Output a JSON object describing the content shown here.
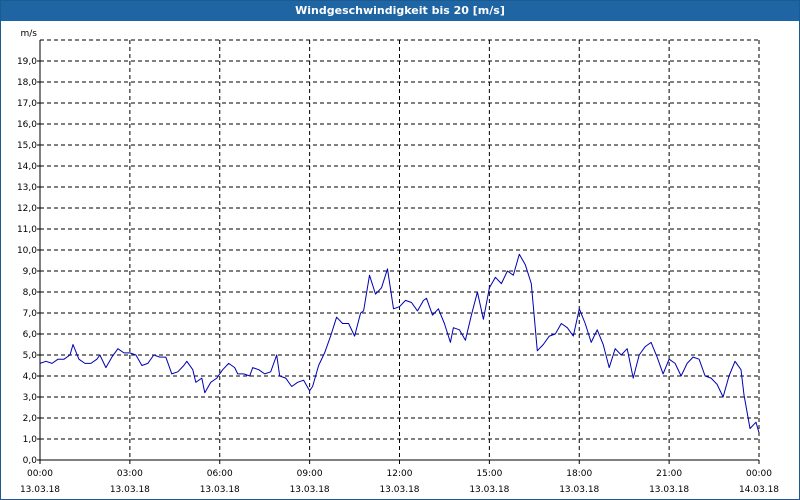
{
  "window": {
    "title": "Windgeschwindigkeit bis 20 [m/s]"
  },
  "chart_data": {
    "type": "line",
    "title": "Windgeschwindigkeit bis 20 [m/s]",
    "ylabel": "m/s",
    "xlabel": "",
    "ylim": [
      0,
      20
    ],
    "yticks": [
      "0,0",
      "1,0",
      "2,0",
      "3,0",
      "4,0",
      "5,0",
      "6,0",
      "7,0",
      "8,0",
      "9,0",
      "10,0",
      "11,0",
      "12,0",
      "13,0",
      "14,0",
      "15,0",
      "16,0",
      "17,0",
      "18,0",
      "19,0"
    ],
    "xlim_hours": [
      0,
      24
    ],
    "xticks": [
      {
        "h": 0,
        "time": "00:00",
        "date": "13.03.18"
      },
      {
        "h": 3,
        "time": "03:00",
        "date": "13.03.18"
      },
      {
        "h": 6,
        "time": "06:00",
        "date": "13.03.18"
      },
      {
        "h": 9,
        "time": "09:00",
        "date": "13.03.18"
      },
      {
        "h": 12,
        "time": "12:00",
        "date": "13.03.18"
      },
      {
        "h": 15,
        "time": "15:00",
        "date": "13.03.18"
      },
      {
        "h": 18,
        "time": "18:00",
        "date": "13.03.18"
      },
      {
        "h": 21,
        "time": "21:00",
        "date": "13.03.18"
      },
      {
        "h": 24,
        "time": "00:00",
        "date": "14.03.18"
      }
    ],
    "grid": true,
    "series": [
      {
        "color": "#0000b4",
        "points": [
          [
            0.0,
            4.6
          ],
          [
            0.2,
            4.7
          ],
          [
            0.4,
            4.6
          ],
          [
            0.6,
            4.8
          ],
          [
            0.8,
            4.8
          ],
          [
            1.0,
            5.0
          ],
          [
            1.1,
            5.5
          ],
          [
            1.3,
            4.8
          ],
          [
            1.5,
            4.6
          ],
          [
            1.7,
            4.6
          ],
          [
            1.9,
            4.8
          ],
          [
            2.0,
            5.0
          ],
          [
            2.2,
            4.4
          ],
          [
            2.4,
            4.9
          ],
          [
            2.6,
            5.3
          ],
          [
            2.8,
            5.1
          ],
          [
            3.0,
            5.1
          ],
          [
            3.2,
            5.0
          ],
          [
            3.4,
            4.5
          ],
          [
            3.6,
            4.6
          ],
          [
            3.8,
            5.0
          ],
          [
            4.0,
            4.9
          ],
          [
            4.2,
            4.9
          ],
          [
            4.4,
            4.1
          ],
          [
            4.6,
            4.2
          ],
          [
            4.8,
            4.5
          ],
          [
            4.9,
            4.7
          ],
          [
            5.1,
            4.3
          ],
          [
            5.2,
            3.7
          ],
          [
            5.4,
            3.9
          ],
          [
            5.5,
            3.2
          ],
          [
            5.7,
            3.7
          ],
          [
            5.9,
            3.9
          ],
          [
            6.1,
            4.3
          ],
          [
            6.3,
            4.6
          ],
          [
            6.5,
            4.4
          ],
          [
            6.6,
            4.1
          ],
          [
            6.8,
            4.1
          ],
          [
            7.0,
            4.0
          ],
          [
            7.1,
            4.4
          ],
          [
            7.3,
            4.3
          ],
          [
            7.5,
            4.1
          ],
          [
            7.7,
            4.2
          ],
          [
            7.9,
            5.0
          ],
          [
            8.0,
            4.0
          ],
          [
            8.2,
            3.9
          ],
          [
            8.4,
            3.5
          ],
          [
            8.6,
            3.7
          ],
          [
            8.8,
            3.8
          ],
          [
            9.0,
            3.3
          ],
          [
            9.1,
            3.5
          ],
          [
            9.3,
            4.5
          ],
          [
            9.5,
            5.1
          ],
          [
            9.7,
            5.9
          ],
          [
            9.9,
            6.8
          ],
          [
            10.1,
            6.5
          ],
          [
            10.3,
            6.5
          ],
          [
            10.5,
            5.9
          ],
          [
            10.7,
            7.0
          ],
          [
            10.8,
            7.1
          ],
          [
            11.0,
            8.8
          ],
          [
            11.2,
            7.9
          ],
          [
            11.4,
            8.2
          ],
          [
            11.6,
            9.1
          ],
          [
            11.8,
            7.2
          ],
          [
            12.0,
            7.3
          ],
          [
            12.2,
            7.6
          ],
          [
            12.4,
            7.5
          ],
          [
            12.6,
            7.1
          ],
          [
            12.8,
            7.6
          ],
          [
            12.9,
            7.7
          ],
          [
            13.1,
            6.9
          ],
          [
            13.3,
            7.2
          ],
          [
            13.5,
            6.5
          ],
          [
            13.7,
            5.6
          ],
          [
            13.8,
            6.3
          ],
          [
            14.0,
            6.2
          ],
          [
            14.2,
            5.7
          ],
          [
            14.4,
            6.9
          ],
          [
            14.6,
            8.0
          ],
          [
            14.8,
            6.7
          ],
          [
            15.0,
            8.2
          ],
          [
            15.2,
            8.7
          ],
          [
            15.4,
            8.4
          ],
          [
            15.6,
            9.0
          ],
          [
            15.8,
            8.8
          ],
          [
            16.0,
            9.8
          ],
          [
            16.2,
            9.3
          ],
          [
            16.4,
            8.4
          ],
          [
            16.6,
            5.2
          ],
          [
            16.8,
            5.5
          ],
          [
            17.0,
            5.9
          ],
          [
            17.2,
            6.0
          ],
          [
            17.4,
            6.5
          ],
          [
            17.6,
            6.3
          ],
          [
            17.8,
            5.9
          ],
          [
            18.0,
            7.2
          ],
          [
            18.2,
            6.5
          ],
          [
            18.4,
            5.6
          ],
          [
            18.6,
            6.2
          ],
          [
            18.8,
            5.5
          ],
          [
            19.0,
            4.4
          ],
          [
            19.2,
            5.3
          ],
          [
            19.4,
            5.0
          ],
          [
            19.6,
            5.3
          ],
          [
            19.8,
            3.9
          ],
          [
            20.0,
            5.0
          ],
          [
            20.2,
            5.4
          ],
          [
            20.4,
            5.6
          ],
          [
            20.6,
            4.9
          ],
          [
            20.8,
            4.1
          ],
          [
            21.0,
            4.8
          ],
          [
            21.2,
            4.6
          ],
          [
            21.4,
            4.0
          ],
          [
            21.6,
            4.6
          ],
          [
            21.8,
            4.9
          ],
          [
            22.0,
            4.8
          ],
          [
            22.2,
            4.0
          ],
          [
            22.4,
            3.9
          ],
          [
            22.6,
            3.6
          ],
          [
            22.8,
            3.0
          ],
          [
            23.0,
            4.0
          ],
          [
            23.2,
            4.7
          ],
          [
            23.4,
            4.3
          ],
          [
            23.5,
            3.1
          ],
          [
            23.7,
            1.5
          ],
          [
            23.9,
            1.8
          ],
          [
            24.0,
            1.3
          ]
        ]
      }
    ]
  }
}
